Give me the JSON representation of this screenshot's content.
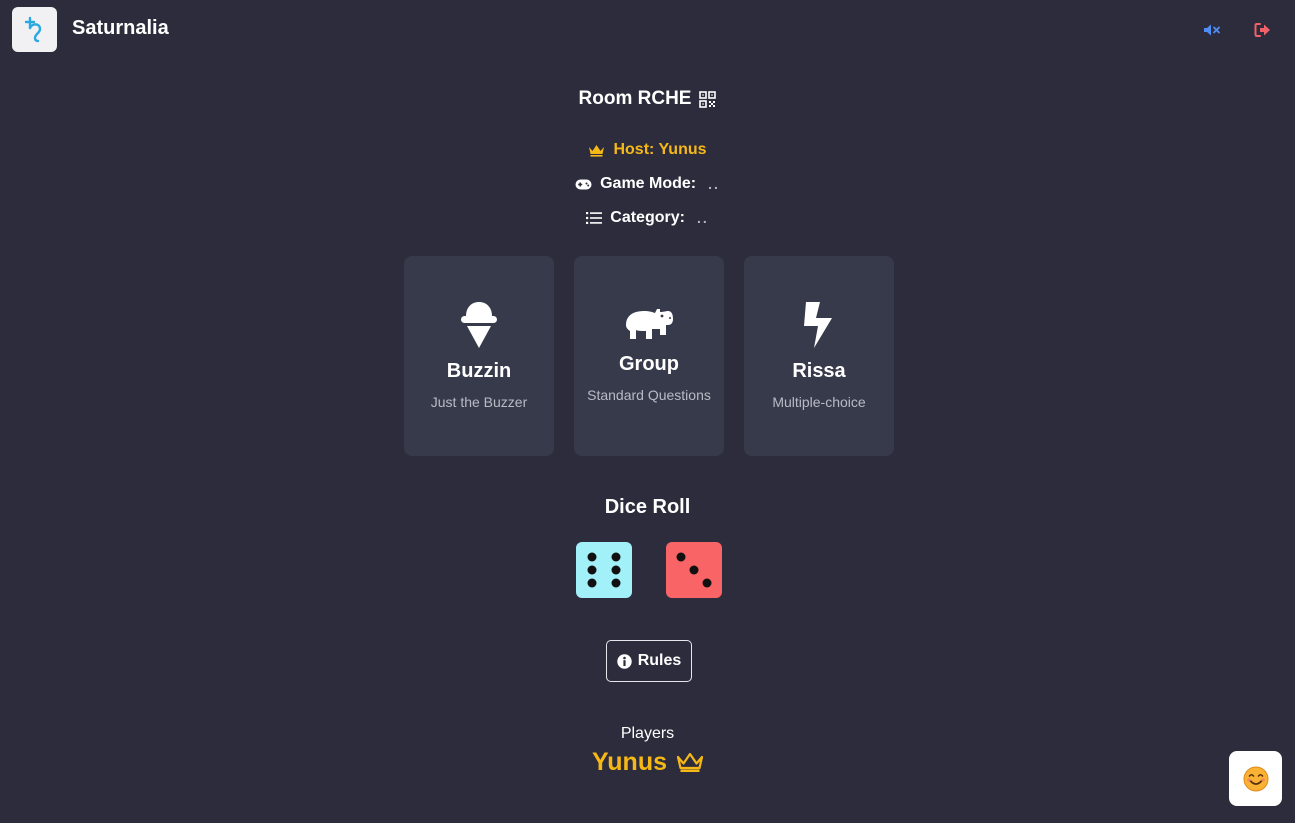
{
  "header": {
    "app_title": "Saturnalia",
    "logo_icon": "saturn-symbol-icon",
    "mute_icon": "volume-mute-icon",
    "exit_icon": "sign-out-icon"
  },
  "room": {
    "title": "Room RCHE",
    "qr_icon": "qr-code-icon"
  },
  "info": {
    "host": "Host: Yunus",
    "game_mode_label": "Game Mode:",
    "game_mode_value": "..",
    "category_label": "Category:",
    "category_value": ".."
  },
  "modes": [
    {
      "title": "Buzzin",
      "subtitle": "Just the Buzzer",
      "icon": "ice-cream-icon"
    },
    {
      "title": "Group",
      "subtitle": "Standard Questions",
      "icon": "hippo-icon"
    },
    {
      "title": "Rissa",
      "subtitle": "Multiple-choice",
      "icon": "bolt-icon"
    }
  ],
  "dice": {
    "title": "Dice Roll",
    "values": [
      6,
      3
    ]
  },
  "rules": {
    "label": "Rules"
  },
  "players": {
    "label": "Players",
    "list": [
      {
        "name": "Yunus",
        "is_host": true
      }
    ]
  },
  "colors": {
    "background": "#2d2c3c",
    "card": "#373a4a",
    "accent_gold": "#f6b817",
    "die1": "#a2f1f9",
    "die2": "#f96566",
    "mute_blue": "#4f8ef7",
    "exit_red": "#f1616a"
  },
  "emoji_button": {
    "emoji": "😊"
  }
}
